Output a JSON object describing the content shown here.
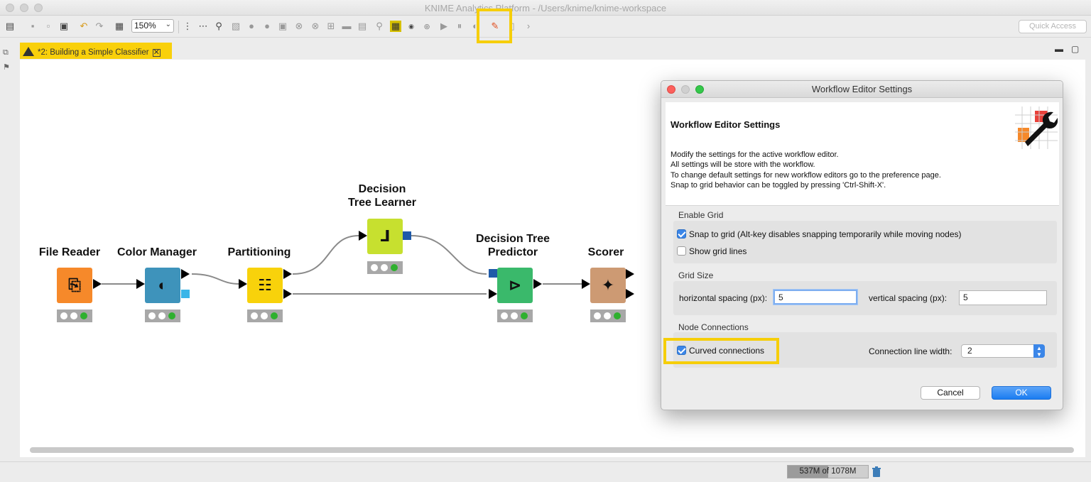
{
  "window": {
    "title": "KNIME Analytics Platform - /Users/knime/knime-workspace"
  },
  "toolbar": {
    "zoom": "150%",
    "quick_access_placeholder": "Quick Access",
    "icons": [
      "new-workflow-icon",
      "save-icon",
      "save-all-icon",
      "save-as-icon",
      "undo-icon",
      "redo-icon",
      "auto-layout-icon",
      "align-vertical-icon",
      "align-horizontal-icon",
      "node-tree-icon",
      "configure-icon",
      "execute-icon",
      "execute-all-icon",
      "cancel-icon",
      "cancel-all-icon",
      "reset-icon",
      "open-view-icon",
      "annotation-icon",
      "open-port-view-icon",
      "search-icon",
      "grid-icon",
      "node-id-icon",
      "node-name-icon",
      "step-icon",
      "pause-icon",
      "resume-icon",
      "workflow-editor-settings-icon",
      "pages-icon",
      "more-icon"
    ]
  },
  "editor": {
    "tab_label": "*2: Building a Simple Classifier"
  },
  "workflow": {
    "nodes": [
      {
        "label": "File Reader",
        "icon": "file-reader-icon",
        "color": "#f6892a"
      },
      {
        "label": "Color Manager",
        "icon": "color-manager-icon",
        "color": "#3e93bb"
      },
      {
        "label": "Partitioning",
        "icon": "partitioning-icon",
        "color": "#f8d20b"
      },
      {
        "label_line1": "Decision",
        "label_line2": "Tree Learner",
        "icon": "decision-tree-learner-icon",
        "color": "#c7e02f"
      },
      {
        "label_line1": "Decision Tree",
        "label_line2": "Predictor",
        "icon": "decision-tree-predictor-icon",
        "color": "#3ab96b"
      },
      {
        "label": "Scorer",
        "icon": "scorer-icon",
        "color": "#cd9a73"
      }
    ],
    "connection_color": "#8a8a8a"
  },
  "dialog": {
    "title": "Workflow Editor Settings",
    "heading": "Workflow Editor Settings",
    "description": [
      "Modify the settings for the active workflow editor.",
      "All settings will be store with the workflow.",
      "To change default settings for new workflow editors go to the preference page.",
      "Snap to grid behavior can be toggled by pressing 'Ctrl-Shift-X'."
    ],
    "enable_grid": {
      "label": "Enable Grid",
      "snap_to_grid": "Snap to grid (Alt-key disables snapping temporarily while moving nodes)",
      "snap_to_grid_checked": true,
      "show_grid_lines": "Show grid lines",
      "show_grid_lines_checked": false
    },
    "grid_size": {
      "label": "Grid Size",
      "horizontal_label": "horizontal spacing (px):",
      "horizontal_value": "5",
      "vertical_label": "vertical spacing (px):",
      "vertical_value": "5"
    },
    "node_connections": {
      "label": "Node Connections",
      "curved_connections": "Curved connections",
      "curved_connections_checked": true,
      "line_width_label": "Connection line width:",
      "line_width_value": "2"
    },
    "cancel": "Cancel",
    "ok": "OK"
  },
  "status": {
    "heap": "537M of 1078M",
    "heap_used_fraction": 0.5
  },
  "colors": {
    "highlight": "#f6ce09",
    "accent": "#3b86e8",
    "tab": "#f9d00b"
  }
}
